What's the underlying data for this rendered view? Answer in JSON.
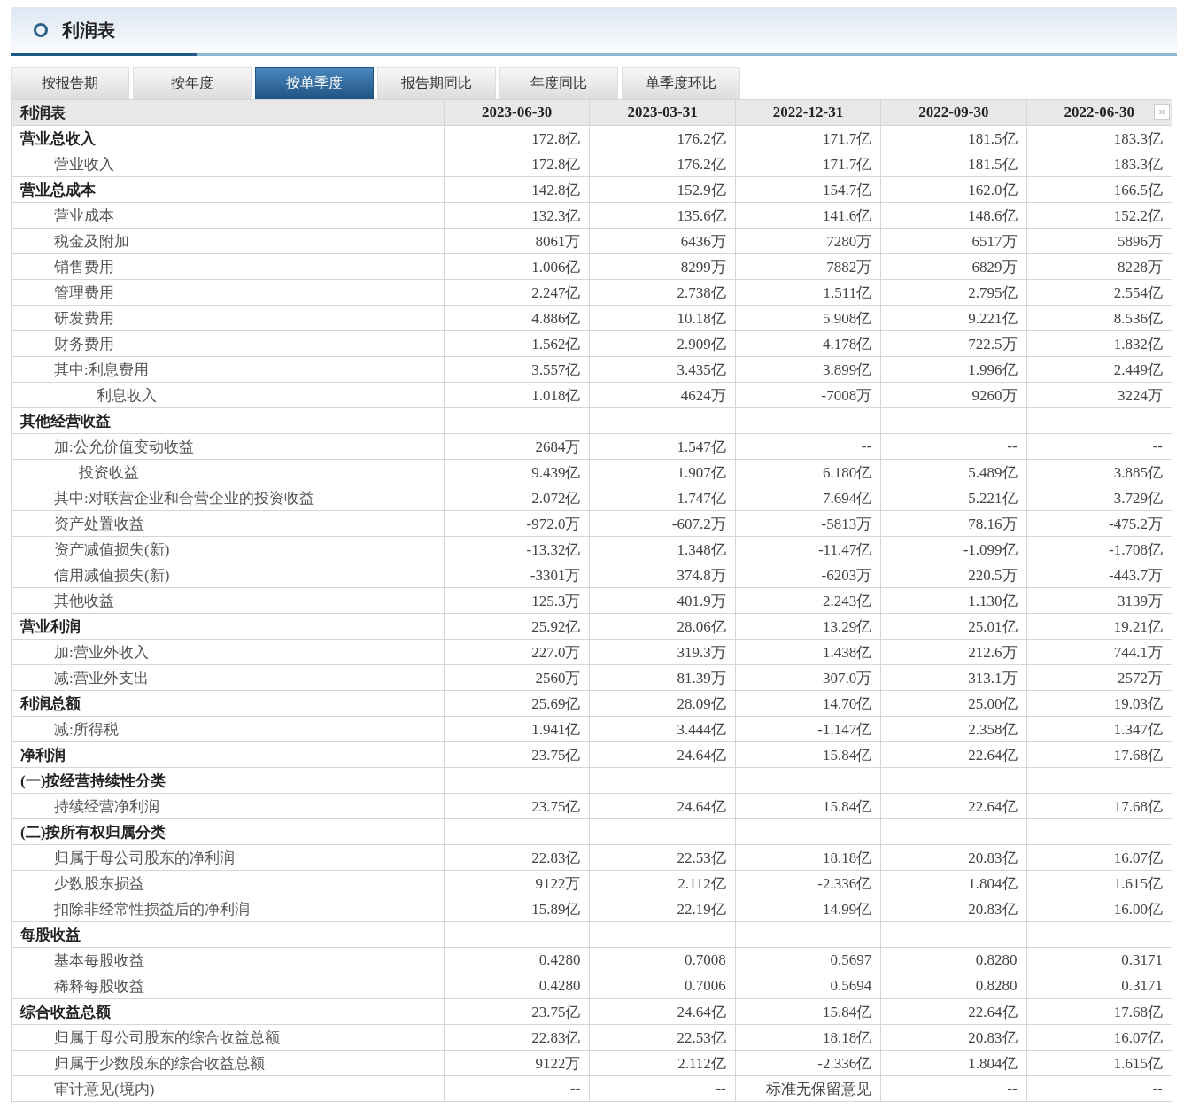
{
  "title": "利润表",
  "tabs": [
    {
      "label": "按报告期",
      "selected": false
    },
    {
      "label": "按年度",
      "selected": false
    },
    {
      "label": "按单季度",
      "selected": true
    },
    {
      "label": "报告期同比",
      "selected": false
    },
    {
      "label": "年度同比",
      "selected": false
    },
    {
      "label": "单季度环比",
      "selected": false
    }
  ],
  "table": {
    "corner": "利润表",
    "columns": [
      "2023-06-30",
      "2023-03-31",
      "2022-12-31",
      "2022-09-30",
      "2022-06-30"
    ],
    "next_symbol": "»",
    "rows": [
      {
        "kind": "total",
        "label": "营业总收入",
        "values": [
          "172.8亿",
          "176.2亿",
          "171.7亿",
          "181.5亿",
          "183.3亿"
        ]
      },
      {
        "kind": "item",
        "label": "营业收入",
        "values": [
          "172.8亿",
          "176.2亿",
          "171.7亿",
          "181.5亿",
          "183.3亿"
        ]
      },
      {
        "kind": "total",
        "label": "营业总成本",
        "values": [
          "142.8亿",
          "152.9亿",
          "154.7亿",
          "162.0亿",
          "166.5亿"
        ]
      },
      {
        "kind": "item",
        "label": "营业成本",
        "values": [
          "132.3亿",
          "135.6亿",
          "141.6亿",
          "148.6亿",
          "152.2亿"
        ]
      },
      {
        "kind": "item",
        "label": "税金及附加",
        "values": [
          "8061万",
          "6436万",
          "7280万",
          "6517万",
          "5896万"
        ]
      },
      {
        "kind": "item",
        "label": "销售费用",
        "values": [
          "1.006亿",
          "8299万",
          "7882万",
          "6829万",
          "8228万"
        ]
      },
      {
        "kind": "item",
        "label": "管理费用",
        "values": [
          "2.247亿",
          "2.738亿",
          "1.511亿",
          "2.795亿",
          "2.554亿"
        ]
      },
      {
        "kind": "item",
        "label": "研发费用",
        "values": [
          "4.886亿",
          "10.18亿",
          "5.908亿",
          "9.221亿",
          "8.536亿"
        ]
      },
      {
        "kind": "item",
        "label": "财务费用",
        "values": [
          "1.562亿",
          "2.909亿",
          "4.178亿",
          "722.5万",
          "1.832亿"
        ]
      },
      {
        "kind": "item",
        "label": "其中:利息费用",
        "values": [
          "3.557亿",
          "3.435亿",
          "3.899亿",
          "1.996亿",
          "2.449亿"
        ]
      },
      {
        "kind": "deep",
        "label": "利息收入",
        "values": [
          "1.018亿",
          "4624万",
          "-7008万",
          "9260万",
          "3224万"
        ]
      },
      {
        "kind": "total",
        "label": "其他经营收益"
      },
      {
        "kind": "item",
        "label": "加:公允价值变动收益",
        "values": [
          "2684万",
          "1.547亿",
          "--",
          "--",
          "--"
        ]
      },
      {
        "kind": "sub",
        "label": "投资收益",
        "values": [
          "9.439亿",
          "1.907亿",
          "6.180亿",
          "5.489亿",
          "3.885亿"
        ]
      },
      {
        "kind": "item",
        "label": "其中:对联营企业和合营企业的投资收益",
        "values": [
          "2.072亿",
          "1.747亿",
          "7.694亿",
          "5.221亿",
          "3.729亿"
        ]
      },
      {
        "kind": "item",
        "label": "资产处置收益",
        "values": [
          "-972.0万",
          "-607.2万",
          "-5813万",
          "78.16万",
          "-475.2万"
        ]
      },
      {
        "kind": "item",
        "label": "资产减值损失(新)",
        "values": [
          "-13.32亿",
          "1.348亿",
          "-11.47亿",
          "-1.099亿",
          "-1.708亿"
        ]
      },
      {
        "kind": "item",
        "label": "信用减值损失(新)",
        "values": [
          "-3301万",
          "374.8万",
          "-6203万",
          "220.5万",
          "-443.7万"
        ]
      },
      {
        "kind": "item",
        "label": "其他收益",
        "values": [
          "125.3万",
          "401.9万",
          "2.243亿",
          "1.130亿",
          "3139万"
        ]
      },
      {
        "kind": "total",
        "label": "营业利润",
        "values": [
          "25.92亿",
          "28.06亿",
          "13.29亿",
          "25.01亿",
          "19.21亿"
        ]
      },
      {
        "kind": "item",
        "label": "加:营业外收入",
        "values": [
          "227.0万",
          "319.3万",
          "1.438亿",
          "212.6万",
          "744.1万"
        ]
      },
      {
        "kind": "item",
        "label": "减:营业外支出",
        "values": [
          "2560万",
          "81.39万",
          "307.0万",
          "313.1万",
          "2572万"
        ]
      },
      {
        "kind": "total",
        "label": "利润总额",
        "values": [
          "25.69亿",
          "28.09亿",
          "14.70亿",
          "25.00亿",
          "19.03亿"
        ]
      },
      {
        "kind": "item",
        "label": "减:所得税",
        "values": [
          "1.941亿",
          "3.444亿",
          "-1.147亿",
          "2.358亿",
          "1.347亿"
        ]
      },
      {
        "kind": "total",
        "label": "净利润",
        "values": [
          "23.75亿",
          "24.64亿",
          "15.84亿",
          "22.64亿",
          "17.68亿"
        ]
      },
      {
        "kind": "total",
        "label": "(一)按经营持续性分类"
      },
      {
        "kind": "item",
        "label": "持续经营净利润",
        "values": [
          "23.75亿",
          "24.64亿",
          "15.84亿",
          "22.64亿",
          "17.68亿"
        ]
      },
      {
        "kind": "total",
        "label": "(二)按所有权归属分类"
      },
      {
        "kind": "item",
        "label": "归属于母公司股东的净利润",
        "values": [
          "22.83亿",
          "22.53亿",
          "18.18亿",
          "20.83亿",
          "16.07亿"
        ]
      },
      {
        "kind": "item",
        "label": "少数股东损益",
        "values": [
          "9122万",
          "2.112亿",
          "-2.336亿",
          "1.804亿",
          "1.615亿"
        ]
      },
      {
        "kind": "item",
        "label": "扣除非经常性损益后的净利润",
        "values": [
          "15.89亿",
          "22.19亿",
          "14.99亿",
          "20.83亿",
          "16.00亿"
        ]
      },
      {
        "kind": "total",
        "label": "每股收益"
      },
      {
        "kind": "item",
        "label": "基本每股收益",
        "values": [
          "0.4280",
          "0.7008",
          "0.5697",
          "0.8280",
          "0.3171"
        ]
      },
      {
        "kind": "item",
        "label": "稀释每股收益",
        "values": [
          "0.4280",
          "0.7006",
          "0.5694",
          "0.8280",
          "0.3171"
        ]
      },
      {
        "kind": "total",
        "label": "综合收益总额",
        "values": [
          "23.75亿",
          "24.64亿",
          "15.84亿",
          "22.64亿",
          "17.68亿"
        ]
      },
      {
        "kind": "item",
        "label": "归属于母公司股东的综合收益总额",
        "values": [
          "22.83亿",
          "22.53亿",
          "18.18亿",
          "20.83亿",
          "16.07亿"
        ]
      },
      {
        "kind": "item",
        "label": "归属于少数股东的综合收益总额",
        "values": [
          "9122万",
          "2.112亿",
          "-2.336亿",
          "1.804亿",
          "1.615亿"
        ]
      },
      {
        "kind": "item",
        "label": "审计意见(境内)",
        "values": [
          "--",
          "--",
          "标准无保留意见",
          "--",
          "--"
        ]
      }
    ]
  }
}
